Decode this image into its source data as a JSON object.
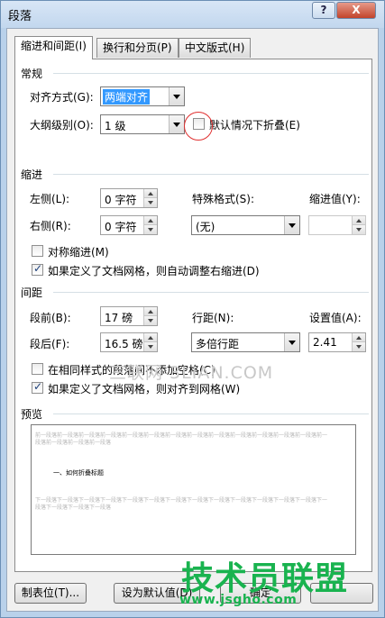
{
  "window": {
    "title": "段落",
    "help_label": "?",
    "close_label": "X"
  },
  "tabs": [
    {
      "label": "缩进和间距(I)",
      "active": true
    },
    {
      "label": "换行和分页(P)",
      "active": false
    },
    {
      "label": "中文版式(H)",
      "active": false
    }
  ],
  "general": {
    "heading": "常规",
    "alignment_label": "对齐方式(G):",
    "alignment_value": "两端对齐",
    "outline_label": "大纲级别(O):",
    "outline_value": "1 级",
    "collapse_label": "默认情况下折叠(E)"
  },
  "indent": {
    "heading": "缩进",
    "left_label": "左侧(L):",
    "left_value": "0 字符",
    "right_label": "右侧(R):",
    "right_value": "0 字符",
    "special_label": "特殊格式(S):",
    "special_value": "(无)",
    "by_label": "缩进值(Y):",
    "by_value": "",
    "mirror_label": "对称缩进(M)",
    "mirror_checked": false,
    "auto_right_label": "如果定义了文档网格，则自动调整右缩进(D)",
    "auto_right_checked": true
  },
  "spacing": {
    "heading": "间距",
    "before_label": "段前(B):",
    "before_value": "17 磅",
    "after_label": "段后(F):",
    "after_value": "16.5 磅",
    "line_label": "行距(N):",
    "line_value": "多倍行距",
    "at_label": "设置值(A):",
    "at_value": "2.41",
    "no_space_label": "在相同样式的段落间不添加空格(C)",
    "no_space_checked": false,
    "snap_grid_label": "如果定义了文档网格，则对齐到网格(W)",
    "snap_grid_checked": true
  },
  "preview": {
    "heading": "预览",
    "prev_text": "前一段落前一段落前一段落前一段落前一段落前一段落前一段落前一段落前一段落前一段落前一段落前一段落前一段落前一段落前一段落前一段落前一段落",
    "main_text": "一、如何折叠标题",
    "next_text": "下一段落下一段落下一段落下一段落下一段落下一段落下一段落下一段落下一段落下一段落下一段落下一段落下一段落下一段落下一段落下一段落下一段落"
  },
  "buttons": {
    "tabs_label": "制表位(T)...",
    "default_label": "设为默认值(D)",
    "ok_label": "确定"
  },
  "watermarks": {
    "sanlian": "三联网 3LIAN.COM",
    "brand": "技术员联盟",
    "url": "www.jsgho.com"
  }
}
